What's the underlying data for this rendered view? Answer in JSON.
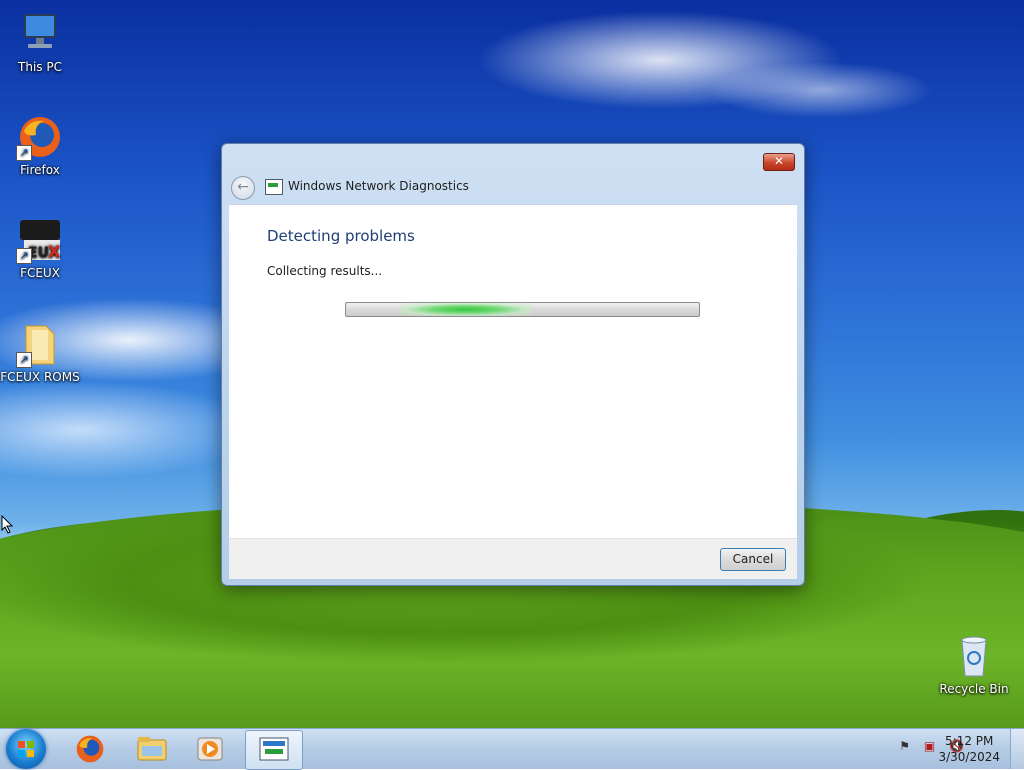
{
  "desktop": {
    "icons": [
      {
        "label": "This PC",
        "icon": "computer-icon"
      },
      {
        "label": "Firefox",
        "icon": "firefox-icon"
      },
      {
        "label": "FCEUX",
        "icon": "fceux-icon"
      },
      {
        "label": "FCEUX ROMS",
        "icon": "folder-icon"
      },
      {
        "label": "Recycle Bin",
        "icon": "recycle-bin-icon"
      }
    ]
  },
  "window": {
    "title": "Windows Network Diagnostics",
    "close_label": "✕",
    "heading": "Detecting problems",
    "status": "Collecting results...",
    "cancel_label": "Cancel",
    "progress_indeterminate": true
  },
  "taskbar": {
    "clock_time": "5:12 PM",
    "clock_date": "3/30/2024",
    "pinned": [
      "start-button",
      "firefox-icon",
      "file-explorer-icon",
      "media-player-icon",
      "network-diagnostics-icon"
    ]
  },
  "colors": {
    "accent": "#1f3f73",
    "progress_glow": "#35c640"
  }
}
